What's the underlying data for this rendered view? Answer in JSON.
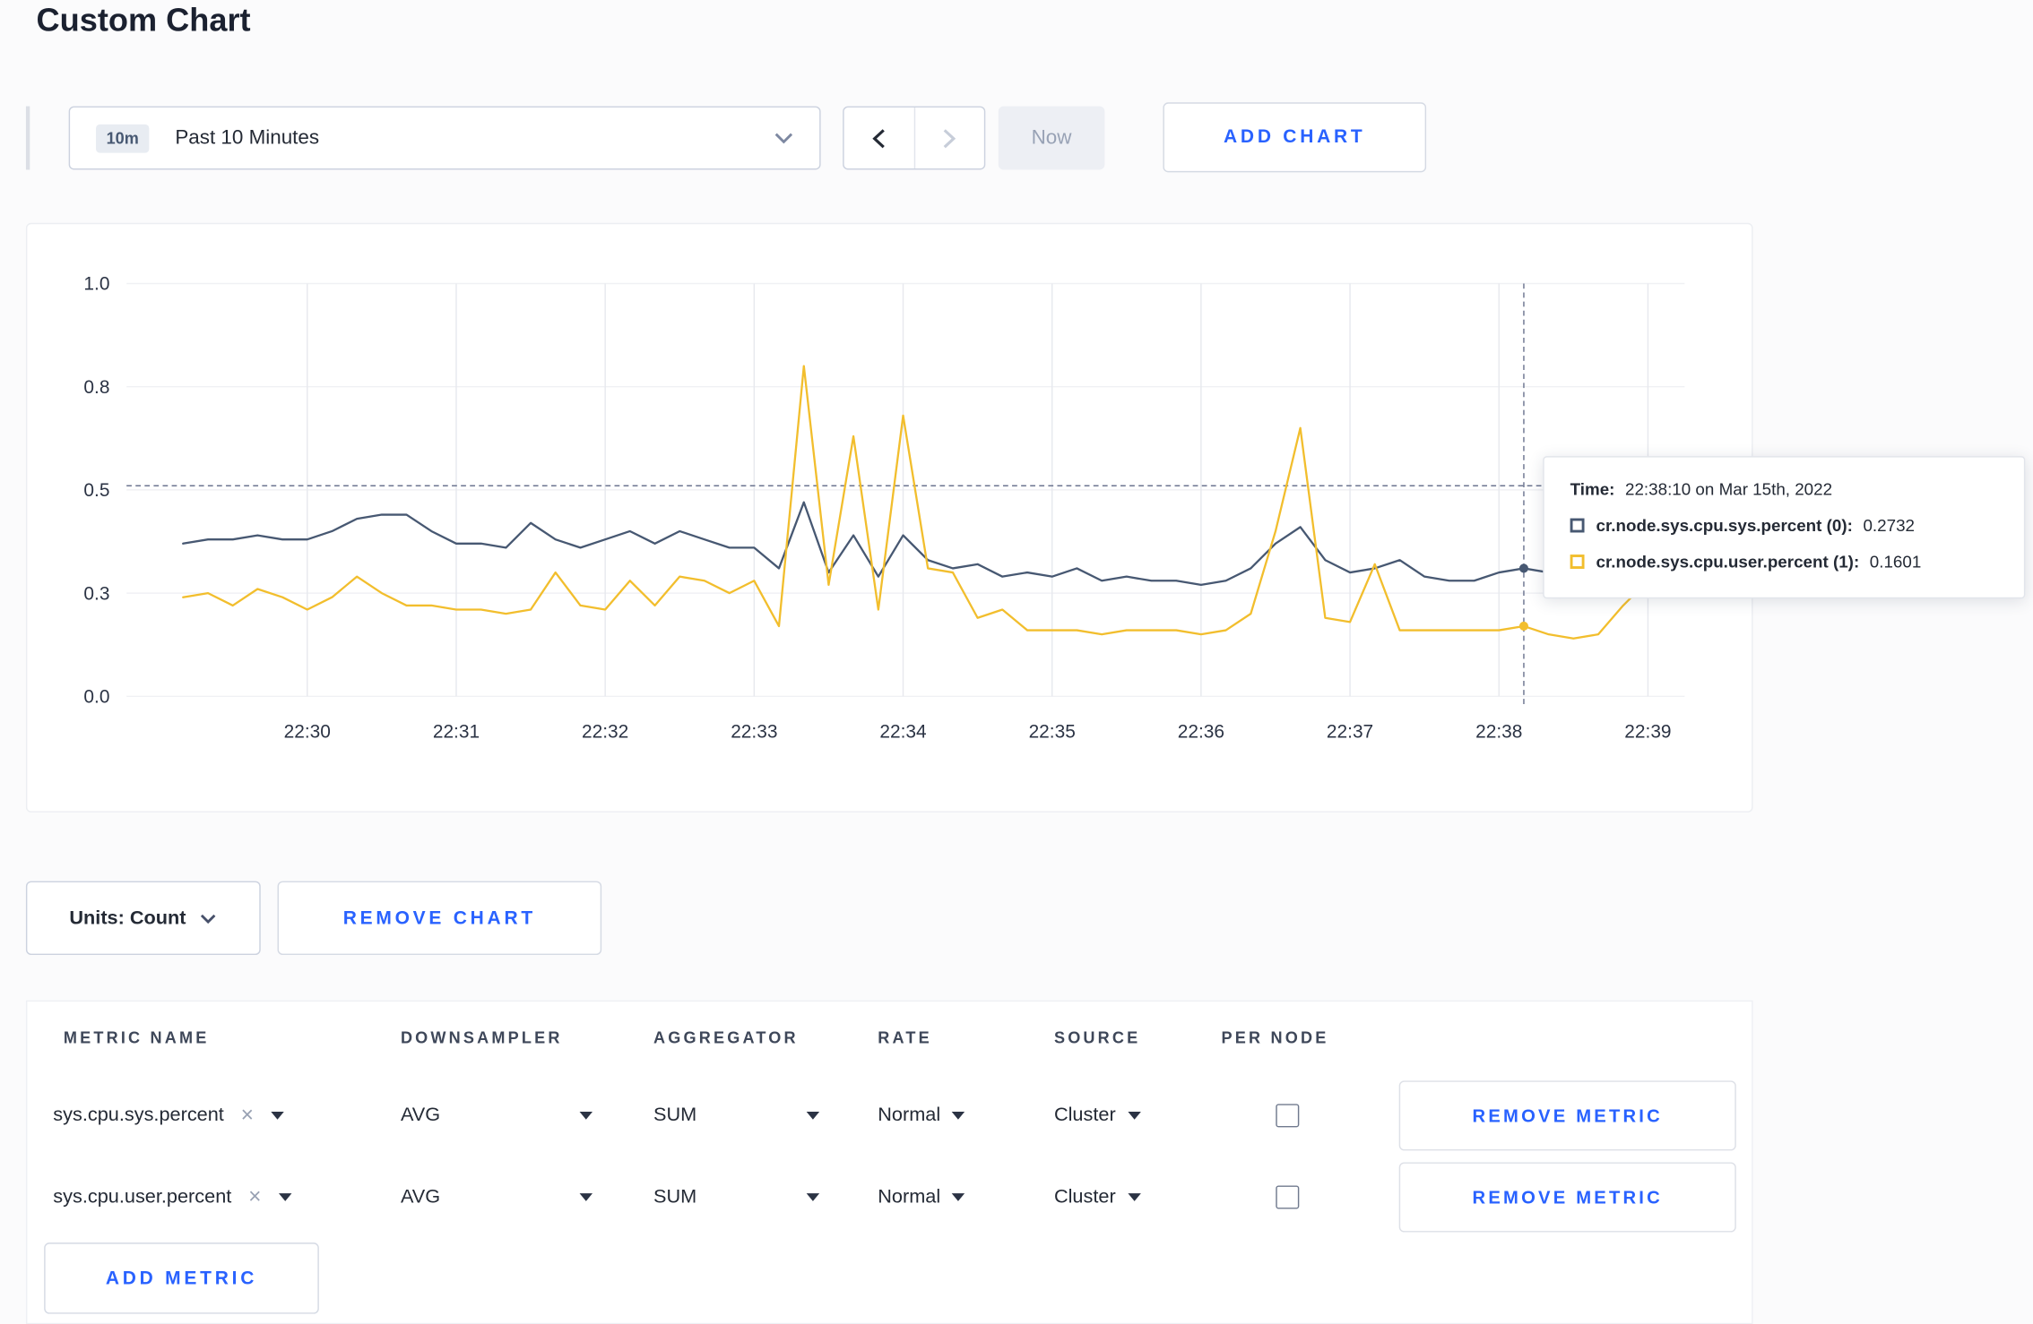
{
  "page": {
    "title": "Custom Chart"
  },
  "theme": {
    "accent_blue": "#2962ff"
  },
  "toolbar": {
    "range_badge": "10m",
    "range_label": "Past 10 Minutes",
    "now_label": "Now",
    "add_chart_label": "ADD CHART"
  },
  "chart": {
    "tooltip": {
      "time_label": "Time:",
      "time_value": "22:38:10 on Mar 15th, 2022",
      "rows": [
        {
          "label": "cr.node.sys.cpu.sys.percent (0):",
          "value": "0.2732"
        },
        {
          "label": "cr.node.sys.cpu.user.percent (1):",
          "value": "0.1601"
        }
      ]
    }
  },
  "chart_data": {
    "type": "line",
    "title": "",
    "xlabel": "",
    "ylabel": "",
    "ylim": [
      0,
      1
    ],
    "grid": true,
    "y_tick_values": [
      0,
      0.25,
      0.5,
      0.75,
      1.0
    ],
    "y_tick_labels": [
      "0.0",
      "0.3",
      "0.5",
      "0.8",
      "1.0"
    ],
    "x_tick_labels": [
      "22:30",
      "22:31",
      "22:32",
      "22:33",
      "22:34",
      "22:35",
      "22:36",
      "22:37",
      "22:38",
      "22:39"
    ],
    "x_tick_offsets_seconds": [
      50,
      110,
      170,
      230,
      290,
      350,
      410,
      470,
      530,
      590
    ],
    "x_start": "22:29:10",
    "x_interval_seconds": 10,
    "guide_value": 0.51,
    "crosshair_index": 54,
    "crosshair_time": "22:38:10",
    "series": [
      {
        "name": "cr.node.sys.cpu.sys.percent",
        "color": "#475872",
        "values": [
          0.37,
          0.38,
          0.38,
          0.39,
          0.38,
          0.38,
          0.4,
          0.43,
          0.44,
          0.44,
          0.4,
          0.37,
          0.37,
          0.36,
          0.42,
          0.38,
          0.36,
          0.38,
          0.4,
          0.37,
          0.4,
          0.38,
          0.36,
          0.36,
          0.31,
          0.47,
          0.3,
          0.39,
          0.29,
          0.39,
          0.33,
          0.31,
          0.32,
          0.29,
          0.3,
          0.29,
          0.31,
          0.28,
          0.29,
          0.28,
          0.28,
          0.27,
          0.28,
          0.31,
          0.37,
          0.41,
          0.33,
          0.3,
          0.31,
          0.33,
          0.29,
          0.28,
          0.28,
          0.3,
          0.31,
          0.3,
          0.29,
          0.3,
          0.31,
          0.3
        ]
      },
      {
        "name": "cr.node.sys.cpu.user.percent",
        "color": "#f2be2d",
        "values": [
          0.24,
          0.25,
          0.22,
          0.26,
          0.24,
          0.21,
          0.24,
          0.29,
          0.25,
          0.22,
          0.22,
          0.21,
          0.21,
          0.2,
          0.21,
          0.3,
          0.22,
          0.21,
          0.28,
          0.22,
          0.29,
          0.28,
          0.25,
          0.28,
          0.17,
          0.8,
          0.27,
          0.63,
          0.21,
          0.68,
          0.31,
          0.3,
          0.19,
          0.21,
          0.16,
          0.16,
          0.16,
          0.15,
          0.16,
          0.16,
          0.16,
          0.15,
          0.16,
          0.2,
          0.4,
          0.65,
          0.19,
          0.18,
          0.32,
          0.16,
          0.16,
          0.16,
          0.16,
          0.16,
          0.17,
          0.15,
          0.14,
          0.15,
          0.22,
          0.28
        ]
      }
    ]
  },
  "chart_footer": {
    "units_label": "Units: Count",
    "remove_chart_label": "REMOVE CHART"
  },
  "metrics_table": {
    "headers": [
      "METRIC NAME",
      "DOWNSAMPLER",
      "AGGREGATOR",
      "RATE",
      "SOURCE",
      "PER NODE"
    ],
    "rows": [
      {
        "metric": "sys.cpu.sys.percent",
        "downsampler": "AVG",
        "aggregator": "SUM",
        "rate": "Normal",
        "source": "Cluster",
        "per_node": false,
        "remove_label": "REMOVE METRIC"
      },
      {
        "metric": "sys.cpu.user.percent",
        "downsampler": "AVG",
        "aggregator": "SUM",
        "rate": "Normal",
        "source": "Cluster",
        "per_node": false,
        "remove_label": "REMOVE METRIC"
      }
    ],
    "add_metric_label": "ADD METRIC"
  }
}
